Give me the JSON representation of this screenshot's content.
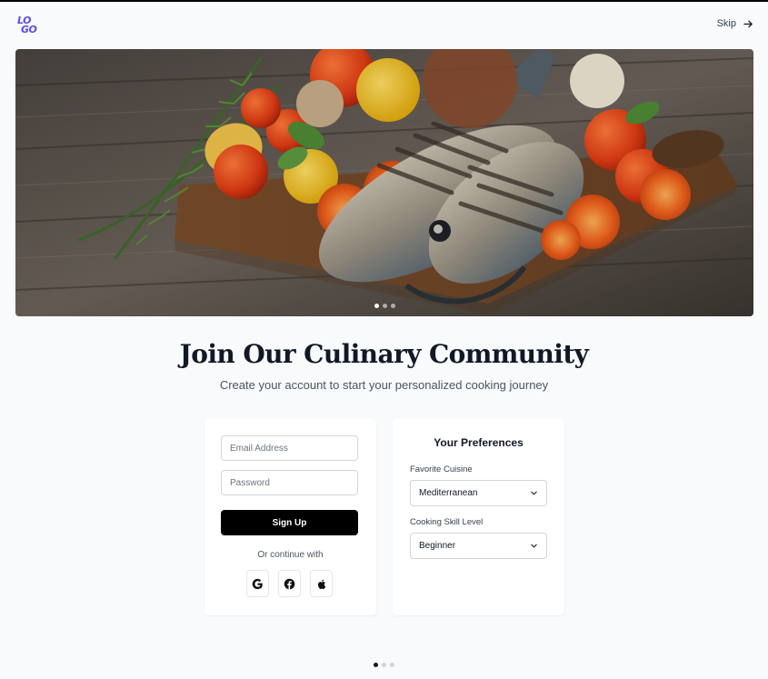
{
  "header": {
    "logo_line1": "LO",
    "logo_line2": "GO",
    "skip_label": "Skip",
    "skip_icon": "arrow-right-icon"
  },
  "hero": {
    "image_subject": "grilled fish with tomatoes and herbs on a wooden board",
    "carousel_dots": 3,
    "active_dot": 1
  },
  "main": {
    "title": "Join Our Culinary Community",
    "subtitle": "Create your account to start your personalized cooking journey"
  },
  "signup": {
    "email_placeholder": "Email Address",
    "password_placeholder": "Password",
    "signup_label": "Sign Up",
    "continue_text": "Or continue with",
    "social_providers": [
      "google-icon",
      "facebook-icon",
      "apple-icon"
    ]
  },
  "preferences": {
    "title": "Your Preferences",
    "cuisine_label": "Favorite Cuisine",
    "cuisine_value": "Mediterranean",
    "skill_label": "Cooking Skill Level",
    "skill_value": "Beginner"
  },
  "pagination": {
    "dots": 3,
    "active": 1
  },
  "colors": {
    "background": "#f8fafc",
    "brand": "#5b4de6",
    "primary_button": "#000000",
    "text": "#111827"
  }
}
